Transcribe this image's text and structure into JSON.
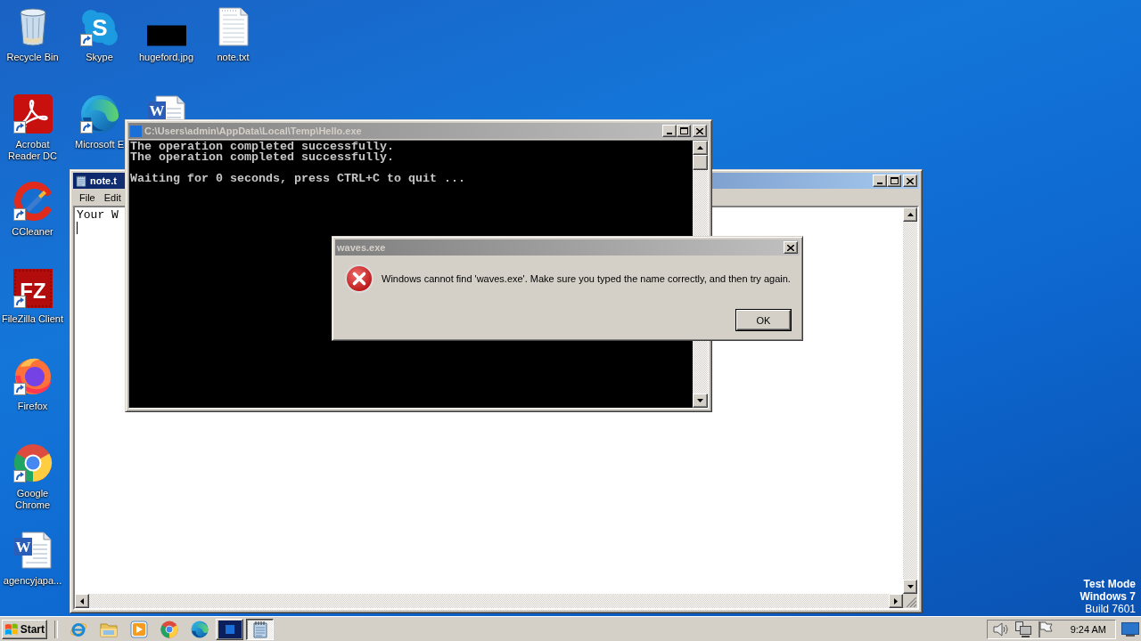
{
  "desktop": {
    "columns": [
      [
        {
          "kind": "recycle-bin",
          "label": "Recycle Bin",
          "shortcut": false
        },
        {
          "kind": "acrobat",
          "label": "Acrobat Reader DC",
          "shortcut": true
        },
        {
          "kind": "ccleaner",
          "label": "CCleaner",
          "shortcut": true
        },
        {
          "kind": "filezilla",
          "label": "FileZilla Client",
          "shortcut": true,
          "glyph": "FZ"
        },
        {
          "kind": "firefox",
          "label": "Firefox",
          "shortcut": true
        },
        {
          "kind": "chrome",
          "label": "Google Chrome",
          "shortcut": true
        },
        {
          "kind": "word-document",
          "label": "agencyjapa...",
          "shortcut": false,
          "glyph": "W"
        }
      ],
      [
        {
          "kind": "skype",
          "label": "Skype",
          "shortcut": true,
          "glyph": "S"
        },
        {
          "kind": "edge",
          "label": "Microsoft E",
          "shortcut": true
        }
      ],
      [
        {
          "kind": "image",
          "label": "hugeford.jpg",
          "shortcut": false
        },
        {
          "kind": "word-document",
          "shortcut": false,
          "glyph": "W"
        }
      ],
      [
        {
          "kind": "text-file",
          "label": "note.txt",
          "shortcut": false
        }
      ]
    ],
    "system_notice": [
      "Test Mode",
      "Windows 7",
      "Build 7601"
    ]
  },
  "notepad": {
    "title": "note.t",
    "active": true,
    "menu": [
      "File",
      "Edit"
    ],
    "text": "Your W"
  },
  "console": {
    "title": "C:\\Users\\admin\\AppData\\Local\\Temp\\Hello.exe",
    "active": false,
    "output": [
      [
        "The operation completed successfully.",
        "The operation completed successfully."
      ],
      [
        "Waiting for 0 seconds, press CTRL+C to quit ..."
      ]
    ]
  },
  "dialog": {
    "title": "waves.exe",
    "active": false,
    "kind": "error",
    "message": "Windows cannot find 'waves.exe'. Make sure you typed the name correctly, and then try again.",
    "buttons": [
      "OK"
    ]
  },
  "taskbar": {
    "start": "Start",
    "quick_launch": [
      {
        "kind": "internet-explorer"
      },
      {
        "kind": "folder"
      },
      {
        "kind": "media-player"
      },
      {
        "kind": "chrome"
      },
      {
        "kind": "edge"
      }
    ],
    "tasks": [
      {
        "kind": "console",
        "selected": false
      },
      {
        "kind": "notepad",
        "selected": true
      }
    ],
    "clock": "9:24 AM"
  }
}
